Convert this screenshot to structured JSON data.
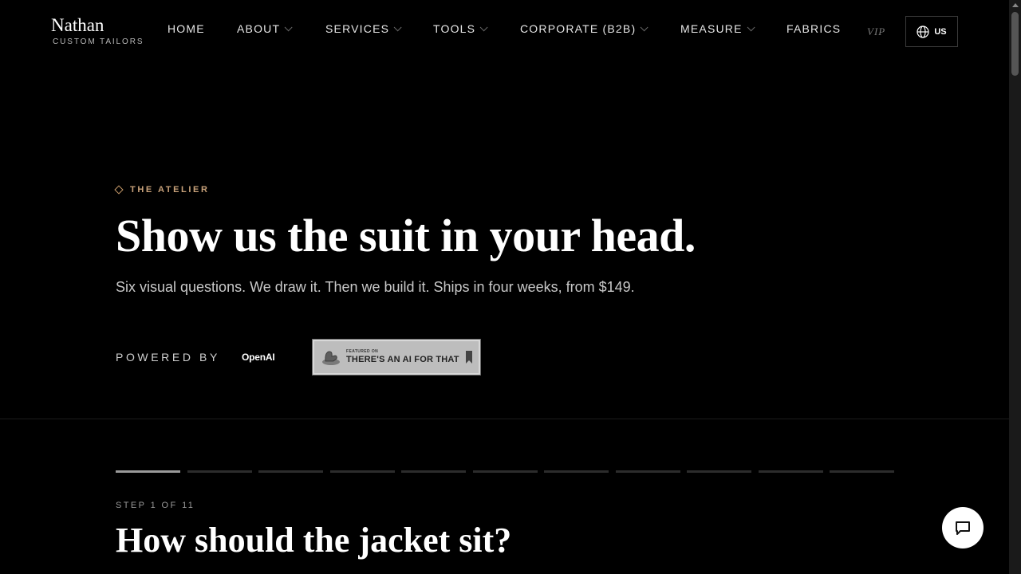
{
  "header": {
    "logo_name": "Nathan",
    "logo_sub": "CUSTOM TAILORS",
    "nav": [
      {
        "label": "HOME",
        "dropdown": false
      },
      {
        "label": "ABOUT",
        "dropdown": true
      },
      {
        "label": "SERVICES",
        "dropdown": true
      },
      {
        "label": "TOOLS",
        "dropdown": true
      },
      {
        "label": "CORPORATE (B2B)",
        "dropdown": true
      },
      {
        "label": "MEASURE",
        "dropdown": true
      },
      {
        "label": "FABRICS",
        "dropdown": false
      }
    ],
    "vip": "VIP",
    "region": "US"
  },
  "hero": {
    "eyebrow": "THE ATELIER",
    "title": "Show us the suit in your head.",
    "subtitle": "Six visual questions. We draw it. Then we build it. Ships in four weeks, from $149.",
    "powered_by": "POWERED BY",
    "partner": "OpenAI",
    "badge_small": "FEATURED ON",
    "badge_big": "THERE'S AN AI FOR THAT"
  },
  "wizard": {
    "step_label": "STEP 1 OF 11",
    "current_step": 1,
    "total_steps": 11,
    "question": "How should the jacket sit?"
  },
  "colors": {
    "background": "#000000",
    "accent": "#c9a27a",
    "progress_active": "#9a9a9a",
    "progress_inactive": "#2c2c2c"
  },
  "icons": {
    "region": "globe-icon",
    "chat": "chat-bubble-icon",
    "eyebrow": "diamond-icon"
  }
}
